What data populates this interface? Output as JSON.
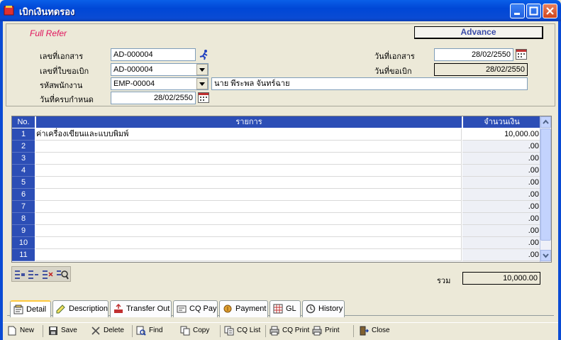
{
  "window": {
    "title": "เบิกเงินทดรอง"
  },
  "header": {
    "mode_label": "Full Refer",
    "advance_label": "Advance",
    "doc_no_label": "เลขที่เอกสาร",
    "doc_no_value": "AD-000004",
    "advance_no_label": "เลขที่ใบขอเบิก",
    "advance_no_value": "AD-000004",
    "employee_label": "รหัสพนักงาน",
    "employee_code": "EMP-00004",
    "employee_name": "นาย พีระพล จันทร์ฉาย",
    "due_date_label": "วันที่ครบกำหนด",
    "due_date_value": "28/02/2550",
    "doc_date_label": "วันที่เอกสาร",
    "doc_date_value": "28/02/2550",
    "request_date_label": "วันที่ขอเบิก",
    "request_date_value": "28/02/2550"
  },
  "grid": {
    "columns": [
      "No.",
      "รายการ",
      "จำนวนเงิน"
    ],
    "rows": [
      {
        "no": "1",
        "item": "ค่าเครื่องเขียนและแบบพิมพ์",
        "amount": "10,000.00"
      },
      {
        "no": "2",
        "item": "",
        "amount": ".00"
      },
      {
        "no": "3",
        "item": "",
        "amount": ".00"
      },
      {
        "no": "4",
        "item": "",
        "amount": ".00"
      },
      {
        "no": "5",
        "item": "",
        "amount": ".00"
      },
      {
        "no": "6",
        "item": "",
        "amount": ".00"
      },
      {
        "no": "7",
        "item": "",
        "amount": ".00"
      },
      {
        "no": "8",
        "item": "",
        "amount": ".00"
      },
      {
        "no": "9",
        "item": "",
        "amount": ".00"
      },
      {
        "no": "10",
        "item": "",
        "amount": ".00"
      },
      {
        "no": "11",
        "item": "",
        "amount": ".00"
      }
    ]
  },
  "total": {
    "label": "รวม",
    "value": "10,000.00"
  },
  "tabs": {
    "detail": "Detail",
    "description": "Description",
    "transfer_out": "Transfer Out",
    "cq_pay": "CQ Pay",
    "payment": "Payment",
    "gl": "GL",
    "history": "History"
  },
  "toolbar": {
    "new": "New",
    "save": "Save",
    "delete": "Delete",
    "find": "Find",
    "copy": "Copy",
    "cq_list": "CQ List",
    "cq_print": "CQ Print",
    "print": "Print",
    "close": "Close"
  },
  "colors": {
    "title_bar": "#0A4BD4",
    "grid_header": "#2C4EB6",
    "mode_label": "#E0105A",
    "advance_text": "#3A4BA8"
  }
}
